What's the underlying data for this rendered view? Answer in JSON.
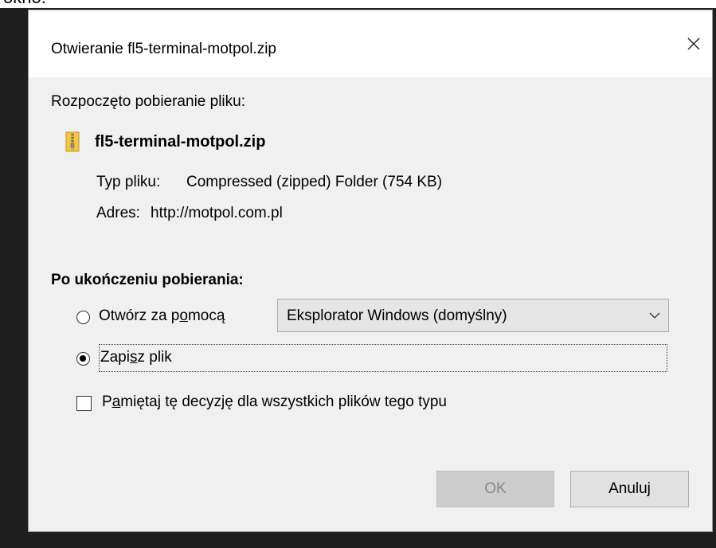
{
  "page": {
    "partial_text": "okno."
  },
  "dialog": {
    "title": "Otwieranie fl5-terminal-motpol.zip",
    "started_label": "Rozpoczęto pobieranie pliku:",
    "file": {
      "icon": "zip-folder-icon",
      "name": "fl5-terminal-motpol.zip",
      "type_key": "Typ pliku:",
      "type_value": "Compressed (zipped) Folder (754 KB)",
      "address_key": "Adres:",
      "address_value": "http://motpol.com.pl"
    },
    "after_download": {
      "title": "Po ukończeniu pobierania:",
      "open_with": {
        "label_pre": "Otwórz za p",
        "label_underline": "o",
        "label_post": "mocą",
        "selected": false,
        "app_selected": "Eksplorator Windows (domyślny)"
      },
      "save_file": {
        "label_pre": "Zapi",
        "label_underline": "s",
        "label_post": "z plik",
        "selected": true
      },
      "remember": {
        "label_pre": "P",
        "label_underline": "a",
        "label_post": "miętaj tę decyzję dla wszystkich plików tego typu",
        "checked": false
      }
    },
    "buttons": {
      "ok_label": "OK",
      "ok_enabled": false,
      "cancel_label": "Anuluj"
    }
  },
  "colors": {
    "dialog_bg": "#f0f0f0",
    "titlebar_bg": "#ffffff",
    "zip_icon_yellow": "#f2c744",
    "disabled_text": "#8a8a8a"
  }
}
